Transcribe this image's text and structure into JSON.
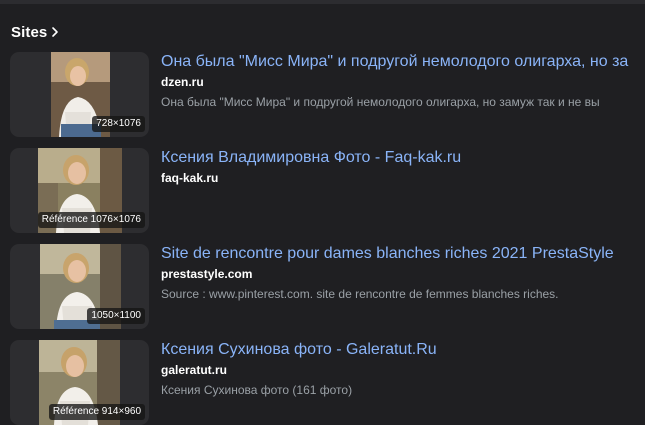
{
  "section": {
    "title": "Sites"
  },
  "results": [
    {
      "title": "Она была \"Мисс Мира\" и подругой немолодого олигарха, но за",
      "domain": "dzen.ru",
      "snippet": "Она была \"Мисс Мира\" и подругой немолодого олигарха, но замуж так и не вы",
      "badge": "728×1076"
    },
    {
      "title": "Ксения Владимировна Фото - Faq-kak.ru",
      "domain": "faq-kak.ru",
      "snippet": "",
      "badge": "Référence 1076×1076"
    },
    {
      "title": "Site de rencontre pour dames blanches riches 2021 PrestaStyle",
      "domain": "prestastyle.com",
      "snippet": "Source : www.pinterest.com. site de rencontre de femmes blanches riches.",
      "badge": "1050×1100"
    },
    {
      "title": "Ксения Сухинова фото - Galeratut.Ru",
      "domain": "galeratut.ru",
      "snippet": "Ксения Сухинова фото (161 фото)",
      "badge": "Référence 914×960"
    }
  ],
  "colors": {
    "background": "#1f1f22",
    "link": "#8ab4f8",
    "domain": "#ffffff",
    "snippet": "#9aa0a6"
  },
  "icons": {
    "header_chevron": "chevron-right-icon"
  }
}
